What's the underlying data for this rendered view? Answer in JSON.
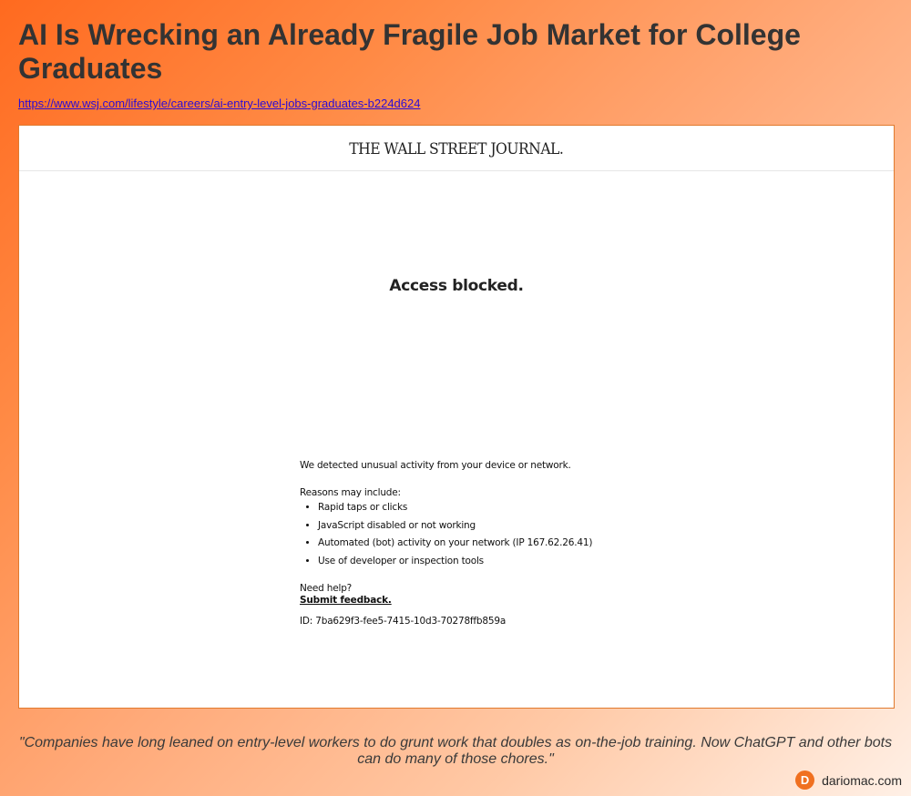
{
  "article": {
    "title": "AI Is Wrecking an Already Fragile Job Market for College Graduates",
    "url": "https://www.wsj.com/lifestyle/careers/ai-entry-level-jobs-graduates-b224d624"
  },
  "screenshot": {
    "logo_text": "THE WALL STREET JOURNAL.",
    "blocked_title": "Access blocked.",
    "detected_text": "We detected unusual activity from your device or network.",
    "reasons_heading": "Reasons may include:",
    "reasons": [
      "Rapid taps or clicks",
      "JavaScript disabled or not working",
      "Automated (bot) activity on your network (IP 167.62.26.41)",
      "Use of developer or inspection tools"
    ],
    "help_text": "Need help?",
    "feedback_label": "Submit feedback.",
    "id_text": "ID: 7ba629f3-fee5-7415-10d3-70278ffb859a"
  },
  "quote": "\"Companies have long leaned on entry-level workers to do grunt work that doubles as on-the-job training. Now ChatGPT and other bots can do many of those chores.\"",
  "brand": {
    "logo_letter": "D",
    "name": "dariomac.com",
    "accent_color": "#f07020"
  },
  "colors": {
    "background_start": "#ff6a1f",
    "background_end": "#fff0e6",
    "link": "#2a0bd6",
    "frame_border": "#e07a2e"
  }
}
